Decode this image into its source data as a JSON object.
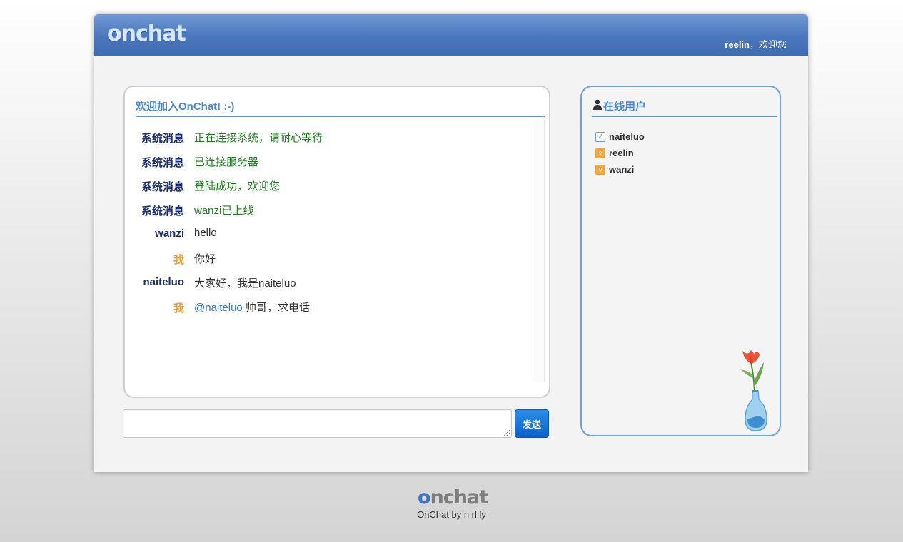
{
  "header": {
    "logo": "onchat",
    "username": "reelin",
    "welcome_suffix": "，欢迎您"
  },
  "chat": {
    "title": "欢迎加入OnChat! :-)",
    "messages": [
      {
        "sender": "系统消息",
        "text": "正在连接系统，请耐心等待",
        "type": "system"
      },
      {
        "sender": "系统消息",
        "text": "已连接服务器",
        "type": "system"
      },
      {
        "sender": "系统消息",
        "text": "登陆成功，欢迎您",
        "type": "system"
      },
      {
        "sender": "系统消息",
        "text": "wanzi已上线",
        "type": "system"
      },
      {
        "sender": "wanzi",
        "text": "hello",
        "type": "user"
      },
      {
        "sender": "我",
        "text": "你好",
        "type": "me"
      },
      {
        "sender": "naiteluo",
        "text": "大家好，我是naiteluo",
        "type": "user"
      },
      {
        "sender": "我",
        "mention": "@naiteluo",
        "text": " 帅哥，求电话",
        "type": "me"
      }
    ],
    "input": {
      "value": "",
      "placeholder": ""
    },
    "send_label": "发送"
  },
  "users": {
    "title": "在线用户",
    "list": [
      {
        "name": "naiteluo",
        "gender": "male"
      },
      {
        "name": "reelin",
        "gender": "female"
      },
      {
        "name": "wanzi",
        "gender": "female"
      }
    ]
  },
  "footer": {
    "logo_bubble": "o",
    "logo_rest": "nchat",
    "credit": "OnChat by n rl ly"
  },
  "colors": {
    "header_blue": "#4a77bd",
    "accent_blue": "#5b9bd5",
    "system_green": "#1e7a1e",
    "sender_navy": "#1b2f6e",
    "me_orange": "#e8a03a",
    "send_button": "#0b62c9"
  }
}
